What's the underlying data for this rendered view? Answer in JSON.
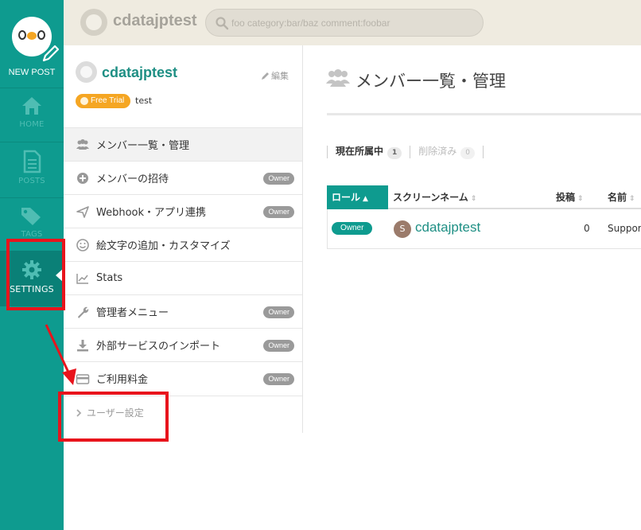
{
  "sidebar": {
    "new_post": "NEW POST",
    "items": [
      {
        "label": "HOME",
        "icon": "home-icon"
      },
      {
        "label": "POSTS",
        "icon": "document-icon"
      },
      {
        "label": "TAGS",
        "icon": "tags-icon"
      },
      {
        "label": "SETTINGS",
        "icon": "gear-icon"
      }
    ]
  },
  "topbar": {
    "team_name": "cdatajptest",
    "search_placeholder": "foo category:bar/baz comment:foobar"
  },
  "panel": {
    "team_name": "cdatajptest",
    "edit_label": "編集",
    "plan_badge": "Free Trial",
    "plan_name": "test",
    "menu": [
      {
        "label": "メンバー一覧・管理",
        "badge": ""
      },
      {
        "label": "メンバーの招待",
        "badge": "Owner"
      },
      {
        "label": "Webhook・アプリ連携",
        "badge": "Owner"
      },
      {
        "label": "絵文字の追加・カスタマイズ",
        "badge": ""
      },
      {
        "label": "Stats",
        "badge": ""
      },
      {
        "label": "管理者メニュー",
        "badge": "Owner"
      },
      {
        "label": "外部サービスのインポート",
        "badge": "Owner"
      },
      {
        "label": "ご利用料金",
        "badge": "Owner"
      }
    ],
    "user_settings": "ユーザー設定"
  },
  "main": {
    "title": "メンバー一覧・管理",
    "tabs": [
      {
        "label": "現在所属中",
        "count": "1"
      },
      {
        "label": "削除済み",
        "count": "0"
      }
    ],
    "table": {
      "headers": [
        "ロール",
        "スクリーンネーム",
        "投稿",
        "名前"
      ],
      "rows": [
        {
          "role": "Owner",
          "avatar_letter": "S",
          "screen_name": "cdatajptest",
          "posts": "0",
          "name": "Suppor"
        }
      ]
    }
  },
  "colors": {
    "brand": "#0e9b8f",
    "annotation": "#e8141c",
    "badge_orange": "#f5a623"
  }
}
